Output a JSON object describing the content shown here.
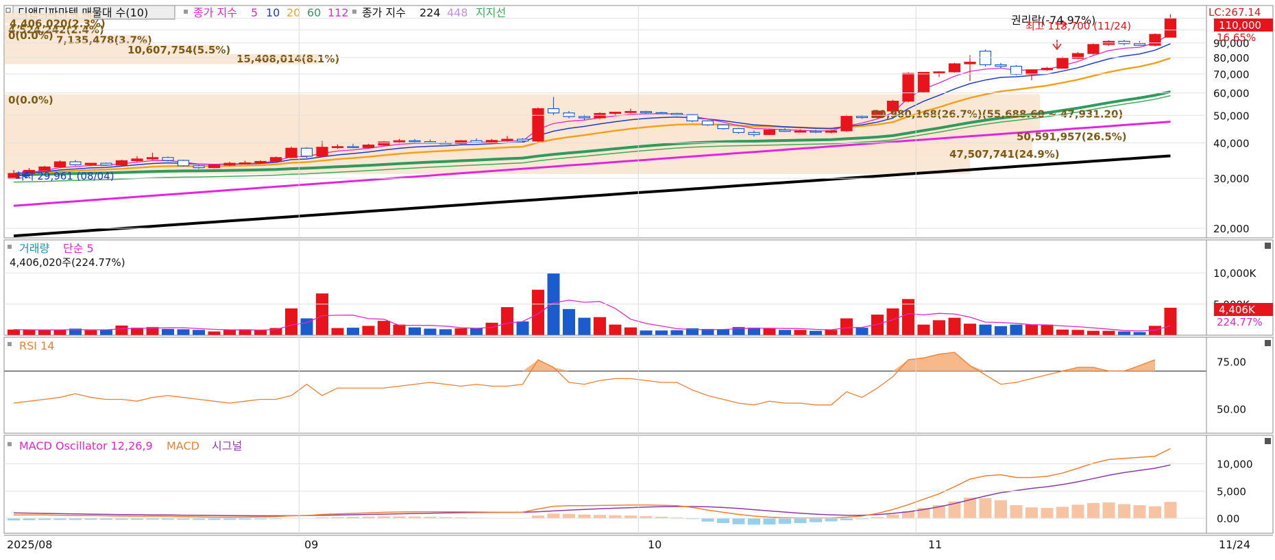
{
  "colors": {
    "up": "#e8141b",
    "down": "#1a5ccc",
    "ma5": "#e224c9",
    "ma10": "#1a3bd0",
    "ma20": "#f3a11b",
    "ma60": "#2e9a5b",
    "ma112": "#e224e0",
    "ma224": "#000000",
    "ma448": "#c390e6",
    "support": "#3daa55",
    "profileBar": "#f9e6d2",
    "profileText": "#7a5a14",
    "rsi": "#f07e2e",
    "rsiFill": "#f7b88a",
    "macd": "#f07e2e",
    "signal": "#8a3aa3",
    "oscPos": "#f7c4a3",
    "oscNeg": "#93d0ee",
    "volMA": "#e224c9"
  },
  "price_panel": {
    "legend": {
      "title": "디앤디파마텍 매물대 수(10)",
      "ma_prefix": "종가 지수",
      "ma_periods": [
        "5",
        "10",
        "20",
        "60",
        "112"
      ],
      "ma2_prefix": "종가 지수",
      "ma2_periods": [
        "224",
        "448"
      ],
      "support": "지지선"
    },
    "lc_label": "LC:267.14",
    "current_price": "110,000",
    "current_change": "16.65%",
    "high_label": "최고 113,700 (11/24)",
    "low_label": "최저 29,961 (08/04)",
    "rights_label": "권리락(-74.97%)",
    "range_label": "50,980,168(26.7%)(55,688.60 ~ 47,931.20)",
    "profile_zero_top": "0(0.0%)",
    "profile_zero_mid": "0(0.0%)",
    "profile_rows": [
      {
        "label": "4,406,020(2.3%)",
        "price": 110000
      },
      {
        "label": "4,524,242(2.4%)",
        "price": 100000
      },
      {
        "label": "7,135,478(3.7%)",
        "price": 92000
      },
      {
        "label": "10,607,754(5.5%)",
        "price": 85000
      },
      {
        "label": "15,408,014(8.1%)",
        "price": 79000
      },
      {
        "label": "50,980,168(26.7%)(55,688.60 ~ 47,931.20)",
        "price": 50500
      },
      {
        "label": "50,591,957(26.5%)",
        "price": 42000
      },
      {
        "label": "47,507,741(24.9%)",
        "price": 36500
      }
    ],
    "y_ticks": [
      "90,000",
      "80,000",
      "70,000",
      "60,000",
      "50,000",
      "40,000",
      "30,000",
      "20,000"
    ],
    "y_tick_values": [
      90000,
      80000,
      70000,
      60000,
      50000,
      40000,
      30000,
      20000
    ]
  },
  "volume_panel": {
    "title": "거래량",
    "ma_label": "단순 5",
    "last_value": "4,406,020주(224.77%)",
    "y_ticks": [
      "10,000K",
      "5,000K"
    ],
    "y_tick_values": [
      10000,
      5000
    ],
    "badge": "4,406K",
    "badge_pct": "224.77%"
  },
  "rsi_panel": {
    "title": "RSI 14",
    "y_ticks": [
      "75.00",
      "50.00"
    ],
    "y_tick_values": [
      75,
      50
    ],
    "level": 70
  },
  "macd_panel": {
    "osc_label": "MACD Oscillator 12,26,9",
    "macd_label": "MACD",
    "signal_label": "시그널",
    "y_ticks": [
      "10,000",
      "5,000",
      "0.00"
    ],
    "y_tick_values": [
      10000,
      5000,
      0
    ]
  },
  "x_axis": {
    "labels": [
      {
        "text": "2025/08",
        "index": 0
      },
      {
        "text": "09",
        "index": 19
      },
      {
        "text": "10",
        "index": 41
      },
      {
        "text": "11",
        "index": 59
      }
    ],
    "end_label": "11/24"
  },
  "chart_data": {
    "type": "candlestick",
    "x_axis_months": [
      "2025/08",
      "09",
      "10",
      "11"
    ],
    "candles": [
      {
        "o": 29961,
        "h": 32100,
        "l": 29961,
        "c": 31200,
        "v": 900
      },
      {
        "o": 31200,
        "h": 32600,
        "l": 30900,
        "c": 32000,
        "v": 850
      },
      {
        "o": 32000,
        "h": 33200,
        "l": 31800,
        "c": 32900,
        "v": 800
      },
      {
        "o": 32900,
        "h": 34700,
        "l": 32700,
        "c": 34300,
        "v": 850
      },
      {
        "o": 34300,
        "h": 34800,
        "l": 33200,
        "c": 33500,
        "v": 1050
      },
      {
        "o": 33500,
        "h": 34000,
        "l": 33100,
        "c": 33900,
        "v": 800
      },
      {
        "o": 33900,
        "h": 34100,
        "l": 33200,
        "c": 33400,
        "v": 850
      },
      {
        "o": 33400,
        "h": 34900,
        "l": 33200,
        "c": 34600,
        "v": 1550
      },
      {
        "o": 34600,
        "h": 35900,
        "l": 34300,
        "c": 35100,
        "v": 1200
      },
      {
        "o": 35100,
        "h": 36900,
        "l": 34800,
        "c": 35500,
        "v": 1300
      },
      {
        "o": 35500,
        "h": 35800,
        "l": 34400,
        "c": 34700,
        "v": 1000
      },
      {
        "o": 34700,
        "h": 34900,
        "l": 33000,
        "c": 33200,
        "v": 950
      },
      {
        "o": 33200,
        "h": 33500,
        "l": 32400,
        "c": 32700,
        "v": 850
      },
      {
        "o": 32700,
        "h": 33700,
        "l": 32500,
        "c": 33400,
        "v": 600
      },
      {
        "o": 33400,
        "h": 34300,
        "l": 33100,
        "c": 33900,
        "v": 900
      },
      {
        "o": 33900,
        "h": 34600,
        "l": 33700,
        "c": 34000,
        "v": 950
      },
      {
        "o": 34000,
        "h": 34700,
        "l": 33700,
        "c": 34400,
        "v": 850
      },
      {
        "o": 34400,
        "h": 35800,
        "l": 34200,
        "c": 35500,
        "v": 1150
      },
      {
        "o": 35500,
        "h": 38800,
        "l": 35300,
        "c": 38300,
        "v": 4300
      },
      {
        "o": 38300,
        "h": 38600,
        "l": 35400,
        "c": 35900,
        "v": 2700
      },
      {
        "o": 35900,
        "h": 40600,
        "l": 35700,
        "c": 38600,
        "v": 6700
      },
      {
        "o": 38600,
        "h": 39500,
        "l": 38100,
        "c": 38800,
        "v": 1150
      },
      {
        "o": 38800,
        "h": 39700,
        "l": 38300,
        "c": 38500,
        "v": 1200
      },
      {
        "o": 38500,
        "h": 39700,
        "l": 38200,
        "c": 39300,
        "v": 1500
      },
      {
        "o": 39300,
        "h": 40600,
        "l": 39100,
        "c": 40300,
        "v": 2300
      },
      {
        "o": 40300,
        "h": 41300,
        "l": 39800,
        "c": 40700,
        "v": 1700
      },
      {
        "o": 40700,
        "h": 41300,
        "l": 40000,
        "c": 40400,
        "v": 1250
      },
      {
        "o": 40400,
        "h": 41100,
        "l": 39800,
        "c": 40000,
        "v": 1050
      },
      {
        "o": 40000,
        "h": 40600,
        "l": 39500,
        "c": 39800,
        "v": 950
      },
      {
        "o": 39800,
        "h": 40900,
        "l": 39600,
        "c": 40700,
        "v": 1100
      },
      {
        "o": 40700,
        "h": 41500,
        "l": 39900,
        "c": 40100,
        "v": 1150
      },
      {
        "o": 40100,
        "h": 41300,
        "l": 39800,
        "c": 40800,
        "v": 2000
      },
      {
        "o": 40800,
        "h": 42300,
        "l": 40400,
        "c": 41200,
        "v": 4500
      },
      {
        "o": 41200,
        "h": 41600,
        "l": 40200,
        "c": 40600,
        "v": 2200
      },
      {
        "o": 40600,
        "h": 53300,
        "l": 40300,
        "c": 52800,
        "v": 7300
      },
      {
        "o": 52800,
        "h": 58100,
        "l": 49900,
        "c": 51000,
        "v": 9900
      },
      {
        "o": 51000,
        "h": 51800,
        "l": 48800,
        "c": 49500,
        "v": 4200
      },
      {
        "o": 49500,
        "h": 50300,
        "l": 48100,
        "c": 49000,
        "v": 2800
      },
      {
        "o": 49000,
        "h": 51200,
        "l": 48500,
        "c": 50800,
        "v": 2900
      },
      {
        "o": 50800,
        "h": 51400,
        "l": 50100,
        "c": 51300,
        "v": 1700
      },
      {
        "o": 51300,
        "h": 52800,
        "l": 50800,
        "c": 51600,
        "v": 1250
      },
      {
        "o": 51600,
        "h": 51900,
        "l": 50600,
        "c": 51100,
        "v": 750
      },
      {
        "o": 51100,
        "h": 51500,
        "l": 50500,
        "c": 50800,
        "v": 750
      },
      {
        "o": 50800,
        "h": 51000,
        "l": 49900,
        "c": 50300,
        "v": 800
      },
      {
        "o": 50300,
        "h": 50500,
        "l": 47300,
        "c": 47800,
        "v": 1100
      },
      {
        "o": 47800,
        "h": 48000,
        "l": 45900,
        "c": 46300,
        "v": 1000
      },
      {
        "o": 46300,
        "h": 46600,
        "l": 44600,
        "c": 44900,
        "v": 950
      },
      {
        "o": 44900,
        "h": 45200,
        "l": 43100,
        "c": 43500,
        "v": 1300
      },
      {
        "o": 43500,
        "h": 44200,
        "l": 42100,
        "c": 42800,
        "v": 1200
      },
      {
        "o": 42800,
        "h": 44700,
        "l": 42600,
        "c": 44400,
        "v": 1100
      },
      {
        "o": 44400,
        "h": 45000,
        "l": 43700,
        "c": 43900,
        "v": 850
      },
      {
        "o": 43900,
        "h": 44600,
        "l": 43500,
        "c": 44000,
        "v": 850
      },
      {
        "o": 44000,
        "h": 44500,
        "l": 43300,
        "c": 43600,
        "v": 700
      },
      {
        "o": 43600,
        "h": 44400,
        "l": 43200,
        "c": 44100,
        "v": 850
      },
      {
        "o": 44100,
        "h": 50300,
        "l": 43800,
        "c": 49600,
        "v": 2700
      },
      {
        "o": 49600,
        "h": 50200,
        "l": 48600,
        "c": 49100,
        "v": 1200
      },
      {
        "o": 49100,
        "h": 52300,
        "l": 48800,
        "c": 51800,
        "v": 3300
      },
      {
        "o": 51800,
        "h": 56700,
        "l": 50900,
        "c": 56100,
        "v": 4300
      },
      {
        "o": 56100,
        "h": 71000,
        "l": 55600,
        "c": 70300,
        "v": 5800
      },
      {
        "o": 60500,
        "h": 71100,
        "l": 60200,
        "c": 70900,
        "v": 1700
      },
      {
        "o": 70900,
        "h": 71600,
        "l": 68300,
        "c": 71200,
        "v": 2400
      },
      {
        "o": 71200,
        "h": 76600,
        "l": 70700,
        "c": 76000,
        "v": 2800
      },
      {
        "o": 76000,
        "h": 81500,
        "l": 66100,
        "c": 77000,
        "v": 1850
      },
      {
        "o": 84200,
        "h": 85300,
        "l": 74300,
        "c": 75400,
        "v": 1700
      },
      {
        "o": 75400,
        "h": 76600,
        "l": 73100,
        "c": 74500,
        "v": 1450
      },
      {
        "o": 74500,
        "h": 75200,
        "l": 69200,
        "c": 69800,
        "v": 1700
      },
      {
        "o": 69800,
        "h": 72700,
        "l": 66500,
        "c": 72400,
        "v": 1700
      },
      {
        "o": 72400,
        "h": 74100,
        "l": 71800,
        "c": 73300,
        "v": 1700
      },
      {
        "o": 73300,
        "h": 80600,
        "l": 73000,
        "c": 79400,
        "v": 900
      },
      {
        "o": 79400,
        "h": 83600,
        "l": 78900,
        "c": 82600,
        "v": 850
      },
      {
        "o": 82600,
        "h": 89600,
        "l": 81800,
        "c": 88900,
        "v": 700
      },
      {
        "o": 88900,
        "h": 92000,
        "l": 88000,
        "c": 91200,
        "v": 700
      },
      {
        "o": 91200,
        "h": 92200,
        "l": 88300,
        "c": 89500,
        "v": 600
      },
      {
        "o": 89500,
        "h": 91500,
        "l": 87900,
        "c": 88300,
        "v": 500
      },
      {
        "o": 88300,
        "h": 97200,
        "l": 87500,
        "c": 96500,
        "v": 1500
      },
      {
        "o": 94300,
        "h": 113700,
        "l": 94100,
        "c": 110000,
        "v": 4406
      }
    ],
    "volume_unit": "K",
    "rsi14": [
      53,
      54,
      55,
      56,
      58,
      56,
      55,
      55,
      54,
      56,
      57,
      56,
      55,
      54,
      53,
      54,
      55,
      55,
      57,
      63,
      57,
      61,
      61,
      61,
      61,
      62,
      63,
      64,
      63,
      62,
      63,
      62,
      62,
      63,
      76,
      72,
      64,
      63,
      65,
      66,
      66,
      65,
      64,
      64,
      60,
      57,
      55,
      53,
      52,
      54,
      53,
      53,
      52,
      52,
      59,
      56,
      61,
      67,
      76,
      77,
      79,
      80,
      73,
      68,
      63,
      64,
      66,
      68,
      70,
      72,
      72,
      70,
      70,
      73,
      76
    ],
    "macd": [
      600,
      600,
      600,
      550,
      500,
      500,
      450,
      400,
      380,
      380,
      350,
      300,
      250,
      200,
      200,
      220,
      250,
      300,
      450,
      500,
      700,
      800,
      900,
      1000,
      1100,
      1150,
      1200,
      1200,
      1200,
      1180,
      1150,
      1120,
      1100,
      1120,
      1700,
      2200,
      2300,
      2300,
      2350,
      2400,
      2450,
      2450,
      2400,
      2300,
      2000,
      1500,
      1100,
      700,
      400,
      200,
      100,
      50,
      40,
      60,
      200,
      400,
      900,
      1600,
      2500,
      3500,
      4500,
      5800,
      7200,
      7800,
      8000,
      7500,
      7500,
      7700,
      8300,
      9200,
      10100,
      10800,
      11000,
      11200,
      11400,
      12800
    ],
    "signal": [
      1000,
      950,
      900,
      850,
      800,
      760,
      720,
      680,
      650,
      620,
      600,
      570,
      540,
      510,
      480,
      460,
      450,
      450,
      470,
      500,
      540,
      590,
      640,
      700,
      760,
      820,
      880,
      930,
      980,
      1020,
      1050,
      1070,
      1080,
      1100,
      1200,
      1350,
      1500,
      1620,
      1740,
      1850,
      1950,
      2050,
      2120,
      2160,
      2150,
      2100,
      1980,
      1800,
      1580,
      1350,
      1130,
      930,
      760,
      630,
      560,
      560,
      680,
      900,
      1200,
      1600,
      2100,
      2700,
      3400,
      4100,
      4700,
      5100,
      5500,
      5800,
      6200,
      6700,
      7300,
      7900,
      8400,
      8800,
      9200,
      9800
    ],
    "oscillator": [
      -400,
      -350,
      -300,
      -300,
      -300,
      -260,
      -270,
      -280,
      -270,
      -240,
      -250,
      -270,
      -290,
      -310,
      -280,
      -240,
      -200,
      -150,
      -20,
      0,
      160,
      210,
      260,
      300,
      340,
      330,
      320,
      270,
      220,
      160,
      100,
      50,
      20,
      20,
      500,
      850,
      800,
      680,
      610,
      550,
      500,
      400,
      280,
      140,
      -150,
      -600,
      -880,
      -1100,
      -1180,
      -1150,
      -1030,
      -880,
      -720,
      -570,
      -360,
      -160,
      220,
      700,
      1300,
      1900,
      2400,
      3100,
      3800,
      3700,
      3300,
      2400,
      2000,
      1900,
      2100,
      2500,
      2800,
      2900,
      2600,
      2400,
      2200,
      3000
    ]
  }
}
